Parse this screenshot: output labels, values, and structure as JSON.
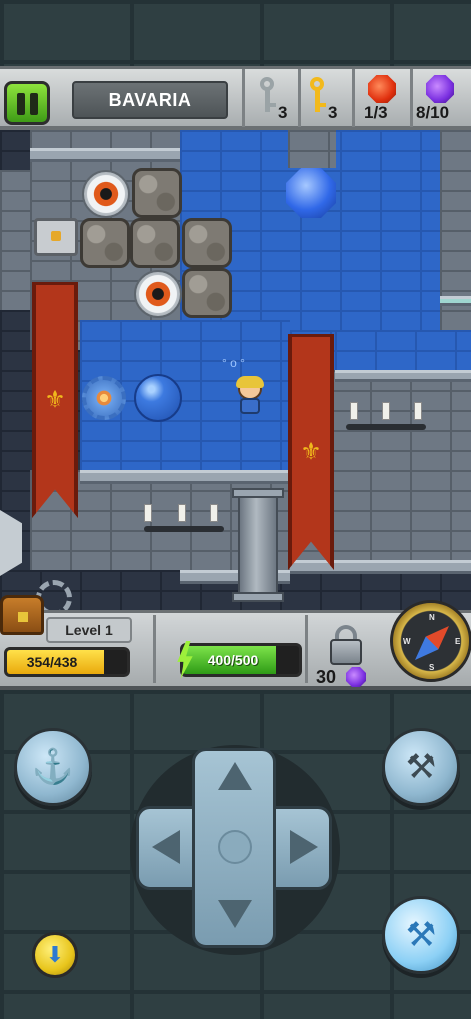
{
  "hud": {
    "level_name": "BAVARIA",
    "silver_keys": "3",
    "gold_keys": "3",
    "red_gems": "1/3",
    "purple_gems": "8/10"
  },
  "player": {
    "level_label": "Level 1",
    "xp_text": "354/438",
    "xp_fraction": 0.808,
    "energy_text": "400/500",
    "energy_fraction": 0.8,
    "unlock_cost": "30"
  },
  "map": {
    "banner_symbol": "⚜",
    "compass_letters": {
      "n": "N",
      "e": "E",
      "s": "S",
      "w": "W"
    }
  },
  "icons": {
    "pause": "pause-icon",
    "silver_key": "silver-key-icon",
    "gold_key": "gold-key-icon",
    "red_gem": "red-gem-icon",
    "purple_gem": "purple-gem-icon",
    "grapple": "grappling-hook-icon",
    "hammer": "hammer-icon",
    "ice_hammer": "ice-hammer-icon",
    "drop": "drop-icon"
  },
  "colors": {
    "accent_green": "#3f9c17",
    "xp_yellow": "#e9a90c",
    "energy_green": "#2e9b16",
    "water_blue": "#2e67c8"
  }
}
